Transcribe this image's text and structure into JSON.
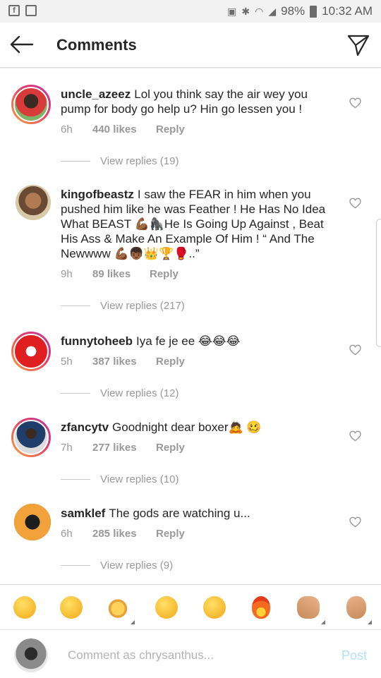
{
  "status_bar": {
    "left_icons": [
      "facebook-icon",
      "image-icon"
    ],
    "battery": "98%",
    "time": "10:32 AM"
  },
  "header": {
    "title": "Comments",
    "back_icon": "back-arrow-icon",
    "direct_icon": "direct-message-icon"
  },
  "comments": [
    {
      "username": "uncle_azeez",
      "text": "Lol you think say the air wey you pump for body go help u? Hin go lessen you !",
      "age": "6h",
      "likes": "440 likes",
      "reply": "Reply",
      "view_replies": "View replies (19)"
    },
    {
      "username": "kingofbeastz",
      "text": "I saw the FEAR in him when you pushed him like he was Feather ! He Has No Idea What BEAST 💪🏾🦍He Is Going Up Against , Beat His Ass & Make An Example Of Him ! “ And The Newwww 💪🏾👦🏾👑🏆🥊..”",
      "age": "9h",
      "likes": "89 likes",
      "reply": "Reply",
      "view_replies": "View replies (217)"
    },
    {
      "username": "funnytoheeb",
      "text": "Iya fe je ee 😂😂😂",
      "age": "5h",
      "likes": "387 likes",
      "reply": "Reply",
      "view_replies": "View replies (12)"
    },
    {
      "username": "zfancytv",
      "text": "Goodnight dear boxer🙇 🥴",
      "age": "7h",
      "likes": "277 likes",
      "reply": "Reply",
      "view_replies": "View replies (10)"
    },
    {
      "username": "samklef",
      "text": "The gods are watching u...",
      "age": "6h",
      "likes": "285 likes",
      "reply": "Reply",
      "view_replies": "View replies (9)"
    }
  ],
  "emoji_bar": [
    "rofl-emoji",
    "joy-emoji",
    "raising-hands-emoji",
    "grin-emoji",
    "eyes-roll-emoji",
    "fire-emoji",
    "clap-hands-emoji",
    "ok-hand-emoji"
  ],
  "composer": {
    "placeholder": "Comment as chrysanthus...",
    "post_label": "Post"
  }
}
